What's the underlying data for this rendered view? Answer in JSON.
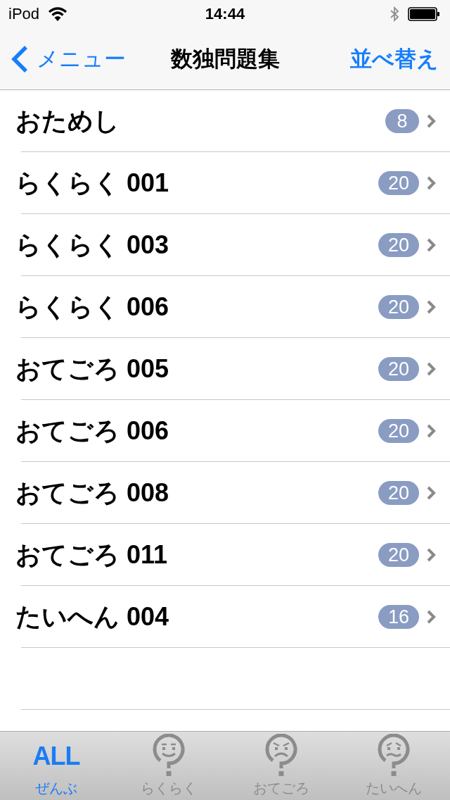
{
  "status_bar": {
    "carrier": "iPod",
    "time": "14:44"
  },
  "nav_bar": {
    "back": "メニュー",
    "title": "数独問題集",
    "action": "並べ替え"
  },
  "list": [
    {
      "title": "おためし",
      "count": "8"
    },
    {
      "title": "らくらく 001",
      "count": "20"
    },
    {
      "title": "らくらく 003",
      "count": "20"
    },
    {
      "title": "らくらく 006",
      "count": "20"
    },
    {
      "title": "おてごろ 005",
      "count": "20"
    },
    {
      "title": "おてごろ 006",
      "count": "20"
    },
    {
      "title": "おてごろ 008",
      "count": "20"
    },
    {
      "title": "おてごろ 011",
      "count": "20"
    },
    {
      "title": "たいへん 004",
      "count": "16"
    }
  ],
  "tab_bar": [
    {
      "kind": "label",
      "icon_text": "ALL",
      "label": "ぜんぶ",
      "selected": true
    },
    {
      "kind": "smile",
      "label": "らくらく",
      "selected": false
    },
    {
      "kind": "frown",
      "label": "おてごろ",
      "selected": false
    },
    {
      "kind": "worried",
      "label": "たいへん",
      "selected": false
    }
  ]
}
